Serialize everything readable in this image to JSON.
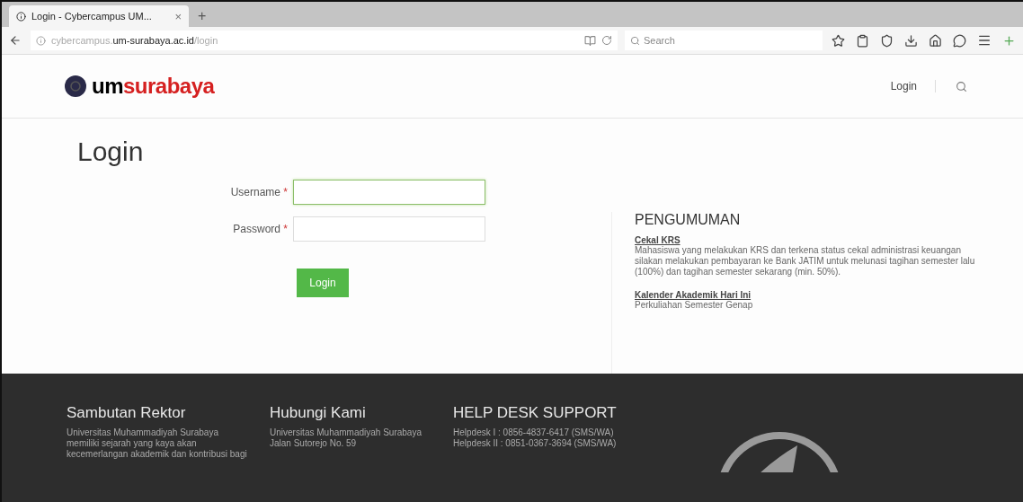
{
  "browser": {
    "tab": {
      "title": "Login - Cybercampus UM...",
      "close": "×",
      "selected": true
    },
    "new_tab": "+",
    "address": {
      "prefix": "cybercampus.",
      "domain": "um-surabaya.ac.id",
      "path": "/login"
    },
    "search": {
      "placeholder": "Search"
    }
  },
  "header": {
    "logo": {
      "part_1": "um",
      "part_2": "surabaya"
    },
    "nav": [
      {
        "label": "Login"
      }
    ]
  },
  "page_title": "Login",
  "form": {
    "fields": [
      {
        "label": "Username",
        "required": "*",
        "focused": true
      },
      {
        "label": "Password",
        "required": "*",
        "focused": false
      }
    ],
    "submit": "Login"
  },
  "announcements": {
    "title": "PENGUMUMAN",
    "items": [
      {
        "heading": "Cekal KRS",
        "body": "Mahasiswa yang melakukan KRS dan terkena status cekal administrasi keuangan silakan melakukan pembayaran ke Bank JATIM untuk melunasi tagihan semester lalu (100%) dan tagihan semester sekarang (min. 50%)."
      },
      {
        "heading": "Kalender Akademik Hari Ini",
        "body": "Perkuliahan Semester Genap"
      }
    ]
  },
  "footer": {
    "columns": [
      {
        "title": "Sambutan Rektor",
        "lines": [
          "Universitas Muhammadiyah Surabaya",
          "memiliki sejarah yang kaya akan",
          "kecemerlangan akademik dan kontribusi bagi"
        ]
      },
      {
        "title": "Hubungi Kami",
        "lines": [
          "Universitas Muhammadiyah Surabaya",
          "Jalan Sutorejo No. 59"
        ]
      },
      {
        "title": "HELP DESK SUPPORT",
        "lines": [
          "Helpdesk I : 0856-4837-6417 (SMS/WA)",
          "Helpdesk II : 0851-0367-3694 (SMS/WA)"
        ]
      }
    ]
  }
}
